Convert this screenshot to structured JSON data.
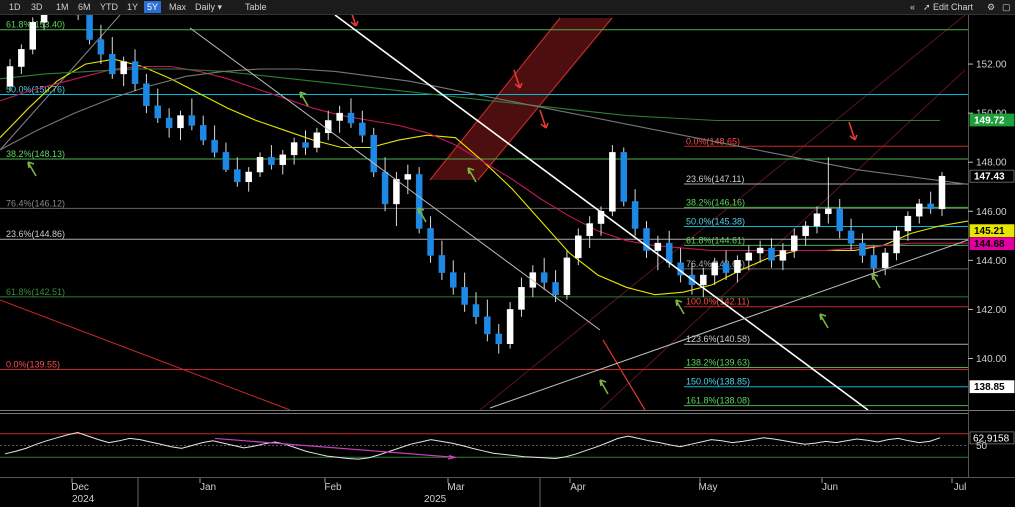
{
  "toolbar": {
    "ranges": [
      "1D",
      "3D",
      "1M",
      "6M",
      "YTD",
      "1Y",
      "5Y",
      "Max"
    ],
    "active_range": "5Y",
    "interval": "Daily",
    "table_label": "Table",
    "edit_chart_label": "Edit Chart"
  },
  "chart_data": {
    "type": "line",
    "price_axis": {
      "ylim": [
        137.9,
        154.0
      ],
      "ticks": [
        140.0,
        142.0,
        144.0,
        146.0,
        148.0,
        150.0,
        152.0
      ]
    },
    "x_axis_labels": [
      {
        "label": "Dec",
        "year": "2024"
      },
      {
        "label": "Jan"
      },
      {
        "label": "Feb"
      },
      {
        "label": "Mar",
        "year": "2025"
      },
      {
        "label": "Apr"
      },
      {
        "label": "May"
      },
      {
        "label": "Jun"
      },
      {
        "label": "Jul"
      }
    ],
    "price_tags": [
      {
        "value": "149.72",
        "bg": "#1f9e3a",
        "fg": "#ffffff",
        "price": 149.72
      },
      {
        "value": "147.43",
        "bg": "#000000",
        "fg": "#ffffff",
        "price": 147.43
      },
      {
        "value": "145.21",
        "bg": "#e6e600",
        "fg": "#000000",
        "price": 145.21
      },
      {
        "value": "144.68",
        "bg": "#e000a0",
        "fg": "#000000",
        "price": 144.68
      },
      {
        "value": "138.85",
        "bg": "#ffffff",
        "fg": "#000000",
        "price": 138.85
      }
    ],
    "fib_left": [
      {
        "text": "61.8%(153.40)",
        "price": 153.4,
        "color": "#4caf50",
        "text_color": "#5fd35f"
      },
      {
        "text": "50.0%(150.76)",
        "price": 150.76,
        "color": "#00bcd4",
        "text_color": "#4fd3e3"
      },
      {
        "text": "38.2%(148.13)",
        "price": 148.13,
        "color": "#4caf50",
        "text_color": "#5fd35f"
      },
      {
        "text": "76.4%(146.12)",
        "price": 146.12,
        "color": "#666666",
        "text_color": "#888888"
      },
      {
        "text": "23.6%(144.86)",
        "price": 144.86,
        "color": "#aaaaaa",
        "text_color": "#cfcfcf"
      },
      {
        "text": "61.8%(142.51)",
        "price": 142.51,
        "color": "#2e7d32",
        "text_color": "#3a8a3a"
      },
      {
        "text": "0.0%(139.55)",
        "price": 139.55,
        "color": "#c62828",
        "text_color": "#ff4d4d"
      }
    ],
    "fib_right": [
      {
        "text": "0.0%(148.65)",
        "price": 148.65,
        "color": "#c62828",
        "text_color": "#ff4d4d"
      },
      {
        "text": "23.6%(147.11)",
        "price": 147.11,
        "color": "#aaaaaa",
        "text_color": "#cfcfcf"
      },
      {
        "text": "38.2%(146.16)",
        "price": 146.16,
        "color": "#4caf50",
        "text_color": "#5fd35f"
      },
      {
        "text": "50.0%(145.38)",
        "price": 145.38,
        "color": "#00bcd4",
        "text_color": "#4fd3e3"
      },
      {
        "text": "61.8%(144.61)",
        "price": 144.61,
        "color": "#4caf50",
        "text_color": "#5fd35f"
      },
      {
        "text": "76.4%(143.65)",
        "price": 143.65,
        "color": "#666666",
        "text_color": "#aaaaaa"
      },
      {
        "text": "100.0%(142.11)",
        "price": 142.11,
        "color": "#c62828",
        "text_color": "#ff4d4d"
      },
      {
        "text": "123.6%(140.58)",
        "price": 140.58,
        "color": "#aaaaaa",
        "text_color": "#cfcfcf"
      },
      {
        "text": "138.2%(139.63)",
        "price": 139.63,
        "color": "#4caf50",
        "text_color": "#5fd35f"
      },
      {
        "text": "150.0%(138.85)",
        "price": 138.85,
        "color": "#00bcd4",
        "text_color": "#4fd3e3"
      },
      {
        "text": "161.8%(138.08)",
        "price": 138.08,
        "color": "#4caf50",
        "text_color": "#5fd35f"
      }
    ],
    "candles": [
      [
        151.1,
        152.2,
        150.9,
        151.9
      ],
      [
        151.9,
        152.8,
        151.6,
        152.6
      ],
      [
        152.6,
        153.9,
        152.4,
        153.7
      ],
      [
        153.7,
        155.2,
        153.4,
        154.8
      ],
      [
        154.8,
        155.3,
        154.3,
        155.1
      ],
      [
        155.1,
        155.5,
        154.7,
        154.9
      ],
      [
        154.9,
        155.2,
        153.8,
        154.0
      ],
      [
        154.0,
        154.4,
        152.8,
        153.0
      ],
      [
        153.0,
        153.6,
        152.0,
        152.4
      ],
      [
        152.4,
        153.1,
        151.4,
        151.6
      ],
      [
        151.6,
        152.3,
        151.1,
        152.1
      ],
      [
        152.1,
        152.6,
        150.9,
        151.2
      ],
      [
        151.2,
        151.6,
        150.0,
        150.3
      ],
      [
        150.3,
        151.0,
        149.6,
        149.8
      ],
      [
        149.8,
        150.2,
        149.0,
        149.4
      ],
      [
        149.4,
        150.1,
        148.9,
        149.9
      ],
      [
        149.9,
        150.6,
        149.3,
        149.5
      ],
      [
        149.5,
        149.9,
        148.7,
        148.9
      ],
      [
        148.9,
        149.5,
        148.2,
        148.4
      ],
      [
        148.4,
        148.8,
        147.6,
        147.7
      ],
      [
        147.7,
        148.2,
        147.0,
        147.2
      ],
      [
        147.2,
        147.8,
        146.8,
        147.6
      ],
      [
        147.6,
        148.4,
        147.4,
        148.2
      ],
      [
        148.2,
        148.7,
        147.7,
        147.9
      ],
      [
        147.9,
        148.5,
        147.5,
        148.3
      ],
      [
        148.3,
        149.0,
        147.9,
        148.8
      ],
      [
        148.8,
        149.3,
        148.3,
        148.6
      ],
      [
        148.6,
        149.4,
        148.4,
        149.2
      ],
      [
        149.2,
        150.1,
        148.9,
        149.7
      ],
      [
        149.7,
        150.3,
        149.2,
        150.0
      ],
      [
        150.0,
        150.6,
        149.4,
        149.6
      ],
      [
        149.6,
        150.1,
        148.8,
        149.1
      ],
      [
        149.1,
        149.4,
        147.4,
        147.6
      ],
      [
        147.6,
        148.2,
        146.0,
        146.3
      ],
      [
        146.3,
        147.6,
        145.4,
        147.3
      ],
      [
        147.3,
        147.9,
        146.7,
        147.5
      ],
      [
        147.5,
        147.8,
        145.1,
        145.3
      ],
      [
        145.3,
        145.8,
        143.9,
        144.2
      ],
      [
        144.2,
        144.8,
        143.2,
        143.5
      ],
      [
        143.5,
        144.0,
        142.6,
        142.9
      ],
      [
        142.9,
        143.5,
        141.9,
        142.2
      ],
      [
        142.2,
        142.7,
        141.4,
        141.7
      ],
      [
        141.7,
        142.4,
        140.7,
        141.0
      ],
      [
        141.0,
        141.4,
        140.2,
        140.6
      ],
      [
        140.6,
        142.3,
        140.4,
        142.0
      ],
      [
        142.0,
        143.3,
        141.7,
        142.9
      ],
      [
        142.9,
        143.8,
        142.5,
        143.5
      ],
      [
        143.5,
        144.1,
        142.8,
        143.1
      ],
      [
        143.1,
        143.6,
        142.3,
        142.6
      ],
      [
        142.6,
        144.4,
        142.4,
        144.1
      ],
      [
        144.1,
        145.3,
        143.8,
        145.0
      ],
      [
        145.0,
        145.8,
        144.5,
        145.5
      ],
      [
        145.5,
        146.2,
        145.0,
        146.0
      ],
      [
        146.0,
        148.7,
        145.8,
        148.4
      ],
      [
        148.4,
        148.6,
        146.2,
        146.4
      ],
      [
        146.4,
        146.9,
        145.0,
        145.3
      ],
      [
        145.3,
        145.6,
        144.1,
        144.4
      ],
      [
        144.4,
        145.0,
        143.6,
        144.7
      ],
      [
        144.7,
        145.2,
        143.7,
        143.9
      ],
      [
        143.9,
        144.5,
        143.1,
        143.4
      ],
      [
        143.4,
        143.9,
        142.6,
        143.0
      ],
      [
        143.0,
        143.7,
        142.5,
        143.4
      ],
      [
        143.4,
        144.1,
        143.0,
        143.9
      ],
      [
        143.9,
        144.4,
        143.2,
        143.5
      ],
      [
        143.5,
        144.2,
        143.1,
        144.0
      ],
      [
        144.0,
        144.6,
        143.6,
        144.3
      ],
      [
        144.3,
        144.8,
        143.9,
        144.5
      ],
      [
        144.5,
        144.9,
        143.7,
        144.0
      ],
      [
        144.0,
        144.7,
        143.6,
        144.4
      ],
      [
        144.4,
        145.3,
        144.1,
        145.0
      ],
      [
        145.0,
        145.6,
        144.6,
        145.4
      ],
      [
        145.4,
        146.2,
        145.1,
        145.9
      ],
      [
        145.9,
        148.2,
        145.5,
        146.1
      ],
      [
        146.1,
        146.5,
        144.9,
        145.2
      ],
      [
        145.2,
        145.7,
        144.4,
        144.7
      ],
      [
        144.7,
        145.1,
        143.9,
        144.2
      ],
      [
        144.2,
        144.6,
        143.3,
        143.7
      ],
      [
        143.7,
        144.5,
        143.4,
        144.3
      ],
      [
        144.3,
        145.4,
        144.0,
        145.2
      ],
      [
        145.2,
        146.0,
        144.8,
        145.8
      ],
      [
        145.8,
        146.5,
        145.5,
        146.3
      ],
      [
        146.3,
        146.8,
        145.9,
        146.1
      ],
      [
        146.1,
        147.6,
        145.8,
        147.43
      ]
    ],
    "moving_averages": [
      {
        "name": "MA-A",
        "color": "#e6e600",
        "values": [
          149.0,
          150.2,
          151.3,
          152.0,
          152.2,
          151.9,
          151.4,
          150.8,
          150.2,
          149.7,
          149.3,
          148.9,
          148.6,
          148.6,
          148.9,
          149.1,
          149.0,
          148.0,
          146.9,
          145.6,
          144.3,
          143.4,
          142.9,
          142.6,
          142.7,
          143.0,
          143.6,
          144.1,
          144.4,
          144.4,
          144.4,
          144.6,
          145.1,
          145.4,
          145.6
        ]
      },
      {
        "name": "MA-B",
        "color": "#c2185b",
        "values": [
          150.5,
          150.9,
          151.2,
          151.5,
          151.8,
          151.9,
          151.9,
          151.7,
          151.4,
          151.0,
          150.6,
          150.2,
          149.9,
          149.7,
          149.5,
          149.2,
          148.7,
          148.0,
          147.3,
          146.5,
          145.8,
          145.2,
          144.8,
          144.6,
          144.5,
          144.4,
          144.4,
          144.4,
          144.4,
          144.4,
          144.5,
          144.6,
          144.7,
          144.7,
          144.7
        ]
      },
      {
        "name": "MA-C",
        "color": "#2e7d32",
        "values": [
          151.4,
          151.6,
          151.7,
          151.8,
          151.8,
          151.7,
          151.5,
          151.3,
          151.1,
          150.9,
          150.7,
          150.5,
          150.3,
          150.1,
          149.9,
          149.8,
          149.7,
          149.7,
          149.7,
          149.7,
          149.7,
          149.7
        ]
      },
      {
        "name": "MA-D",
        "color": "#777777",
        "values": [
          148.5,
          149.3,
          150.0,
          150.6,
          151.1,
          151.5,
          151.7,
          151.8,
          151.8,
          151.7,
          151.5,
          151.3,
          151.0,
          150.7,
          150.4,
          150.1,
          149.8,
          149.5,
          149.2,
          148.9,
          148.6,
          148.3,
          148.0,
          147.7,
          147.5,
          147.3,
          147.1
        ]
      }
    ],
    "rsi": {
      "last_value": "62.9158",
      "tick": "50",
      "levels": [
        70,
        50,
        30
      ],
      "ylim": [
        0,
        100
      ],
      "values": [
        36,
        40,
        45,
        52,
        58,
        63,
        68,
        72,
        66,
        60,
        55,
        58,
        62,
        60,
        56,
        52,
        48,
        45,
        50,
        55,
        58,
        54,
        50,
        46,
        49,
        53,
        56,
        52,
        46,
        40,
        36,
        32,
        30,
        28,
        27,
        29,
        34,
        40,
        46,
        52,
        56,
        60,
        57,
        54,
        50,
        45,
        41,
        37,
        35,
        33,
        31,
        30,
        29,
        28,
        31,
        36,
        42,
        48,
        55,
        62,
        66,
        62,
        58,
        55,
        51,
        48,
        52,
        56,
        60,
        58,
        55,
        57,
        60,
        63,
        61,
        58,
        55,
        52,
        54,
        57,
        55,
        58,
        61,
        59,
        56,
        60,
        62,
        58,
        55,
        57,
        63
      ]
    },
    "legend": "none",
    "grid": "off"
  }
}
